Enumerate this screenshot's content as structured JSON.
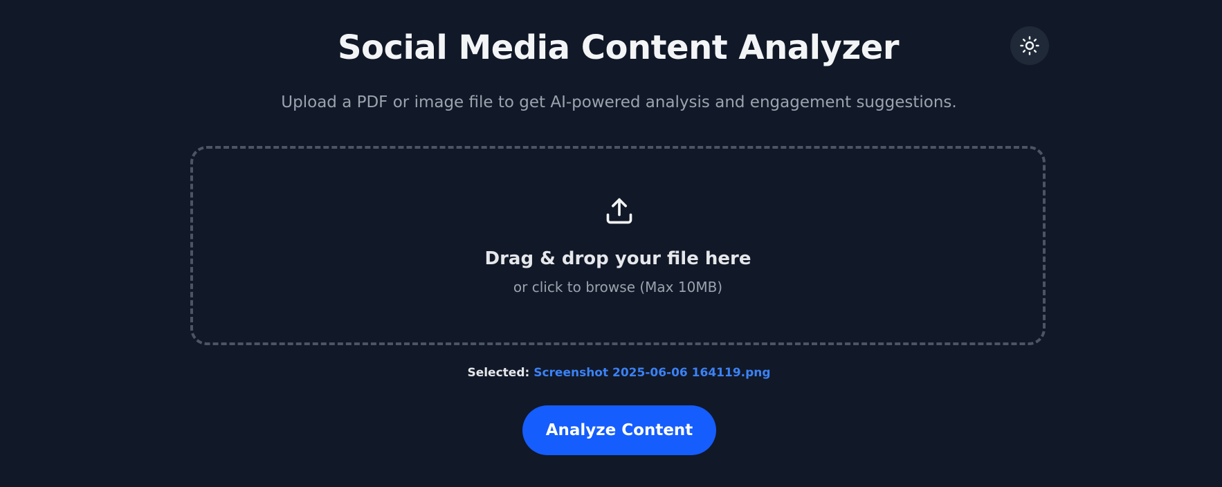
{
  "header": {
    "title": "Social Media Content Analyzer",
    "subtitle": "Upload a PDF or image file to get AI-powered analysis and engagement suggestions.",
    "theme_toggle_icon": "sun-icon"
  },
  "dropzone": {
    "icon": "upload-icon",
    "title": "Drag & drop your file here",
    "hint": "or click to browse (Max 10MB)"
  },
  "selection": {
    "label": "Selected: ",
    "filename": "Screenshot 2025-06-06 164119.png"
  },
  "actions": {
    "analyze_label": "Analyze Content"
  },
  "colors": {
    "background": "#111827",
    "accent": "#155dfc",
    "filename": "#3b82f6",
    "dropzone_border": "#4b5563"
  }
}
